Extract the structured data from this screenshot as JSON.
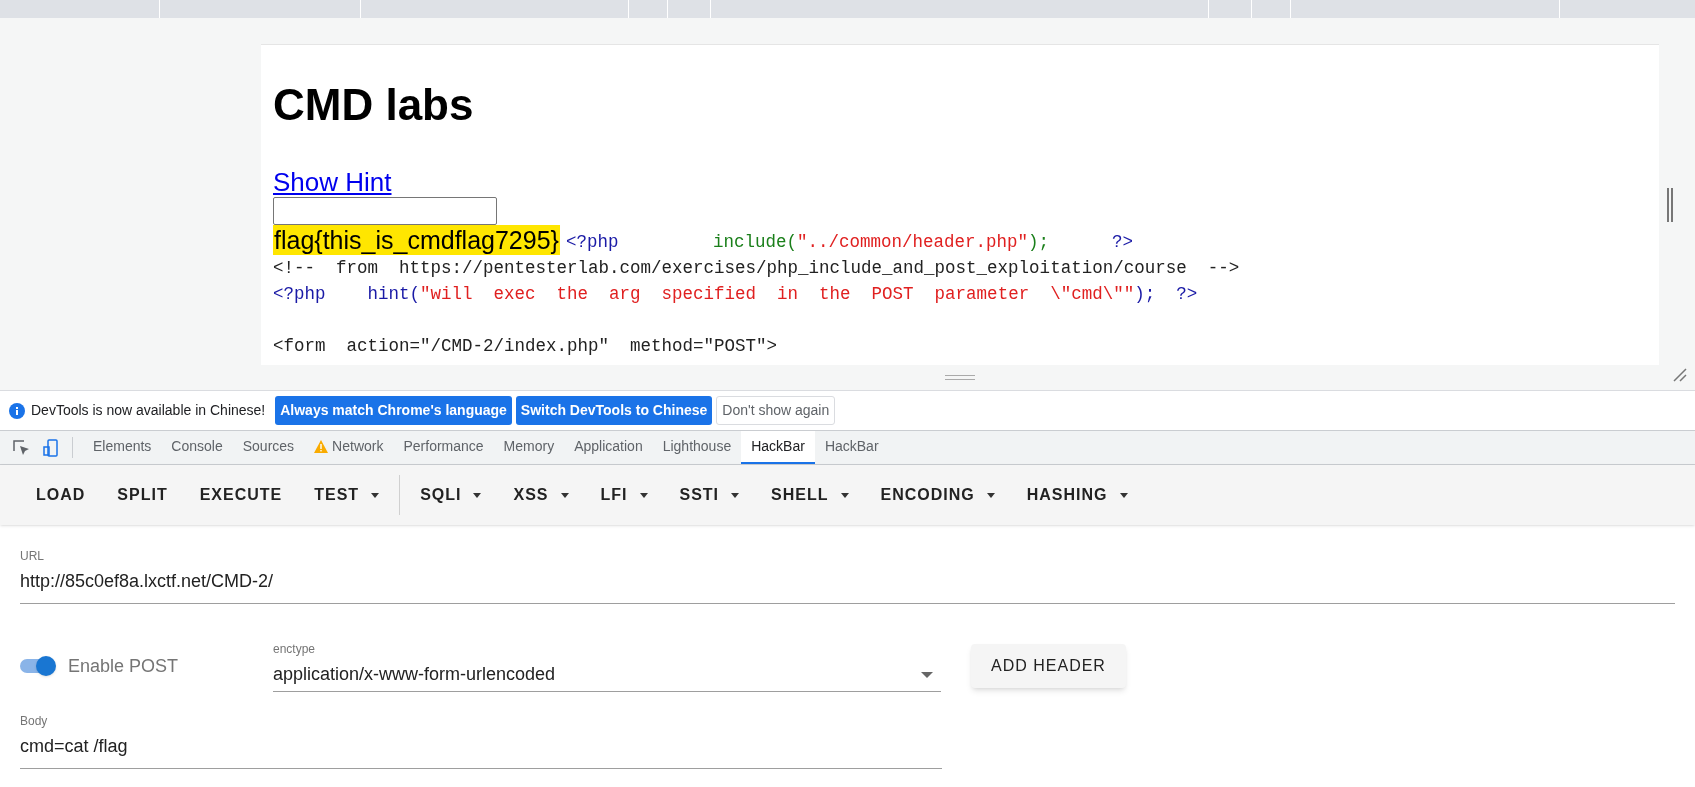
{
  "page": {
    "heading": "CMD labs",
    "hint_link": "Show Hint",
    "flag": {
      "text": "flag{this_is_cmdflag7295}",
      "highlighted": true
    },
    "code_lines": [
      {
        "kind": "code",
        "segments": [
          {
            "text": "<?php         ",
            "kind": "tag"
          },
          {
            "text": "include(",
            "kind": "func"
          },
          {
            "text": "\"../common/header.php\"",
            "kind": "string"
          },
          {
            "text": ");      ",
            "kind": "func"
          },
          {
            "text": "?>",
            "kind": "tag"
          }
        ]
      },
      {
        "kind": "code",
        "segments": [
          {
            "text": "<!--  from  https://pentesterlab.com/exercises/php_include_and_post_exploitation/course  -->",
            "kind": "plain"
          }
        ]
      },
      {
        "kind": "code",
        "segments": [
          {
            "text": "<?php    hint(",
            "kind": "tag"
          },
          {
            "text": "\"will  exec  the  arg  specified  in  the  POST  parameter  \\\"cmd\\\"\"",
            "kind": "string"
          },
          {
            "text": ");  ?>",
            "kind": "tag"
          }
        ]
      },
      {
        "kind": "blank"
      },
      {
        "kind": "code",
        "segments": [
          {
            "text": "<form  action=\"/CMD-2/index.php\"  method=\"POST\">",
            "kind": "plain"
          }
        ]
      }
    ]
  },
  "infobar": {
    "message": "DevTools is now available in Chinese!",
    "buttons": [
      {
        "label": "Always match Chrome's language",
        "kind": "primary"
      },
      {
        "label": "Switch DevTools to Chinese",
        "kind": "primary"
      },
      {
        "label": "Don't show again",
        "kind": "outline"
      }
    ]
  },
  "tabs": [
    {
      "label": "Elements",
      "selected": false,
      "warning": false
    },
    {
      "label": "Console",
      "selected": false,
      "warning": false
    },
    {
      "label": "Sources",
      "selected": false,
      "warning": false
    },
    {
      "label": "Network",
      "selected": false,
      "warning": true
    },
    {
      "label": "Performance",
      "selected": false,
      "warning": false
    },
    {
      "label": "Memory",
      "selected": false,
      "warning": false
    },
    {
      "label": "Application",
      "selected": false,
      "warning": false
    },
    {
      "label": "Lighthouse",
      "selected": false,
      "warning": false
    },
    {
      "label": "HackBar",
      "selected": true,
      "warning": false
    },
    {
      "label": "HackBar",
      "selected": false,
      "warning": false
    }
  ],
  "hackbar": {
    "toolbar_groups": [
      {
        "buttons": [
          {
            "label": "LOAD",
            "dropdown": false
          },
          {
            "label": "SPLIT",
            "dropdown": false
          },
          {
            "label": "EXECUTE",
            "dropdown": false
          },
          {
            "label": "TEST",
            "dropdown": true
          }
        ]
      },
      {
        "buttons": [
          {
            "label": "SQLI",
            "dropdown": true
          },
          {
            "label": "XSS",
            "dropdown": true
          },
          {
            "label": "LFI",
            "dropdown": true
          },
          {
            "label": "SSTI",
            "dropdown": true
          },
          {
            "label": "SHELL",
            "dropdown": true
          },
          {
            "label": "ENCODING",
            "dropdown": true
          },
          {
            "label": "HASHING",
            "dropdown": true
          }
        ]
      }
    ],
    "url": {
      "label": "URL",
      "value": "http://85c0ef8a.lxctf.net/CMD-2/"
    },
    "enable_post": {
      "label": "Enable POST",
      "on": true
    },
    "enctype": {
      "label": "enctype",
      "value": "application/x-www-form-urlencoded"
    },
    "add_header": "ADD HEADER",
    "body": {
      "label": "Body",
      "value": "cmd=cat /flag"
    }
  }
}
